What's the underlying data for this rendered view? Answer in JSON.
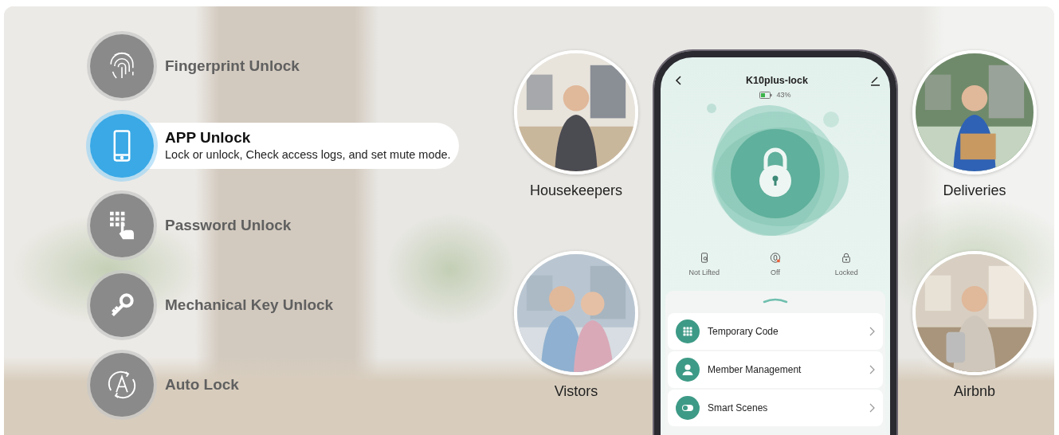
{
  "features": [
    {
      "kind": "fingerprint",
      "title": "Fingerprint Unlock",
      "selected": false
    },
    {
      "kind": "phone",
      "title": "APP Unlock",
      "description": "Lock or unlock, Check access logs, and set mute mode.",
      "selected": true
    },
    {
      "kind": "keypad",
      "title": "Password Unlock",
      "selected": false
    },
    {
      "kind": "key",
      "title": "Mechanical Key Unlock",
      "selected": false
    },
    {
      "kind": "auto",
      "title": "Auto Lock",
      "selected": false
    }
  ],
  "audiences_left": [
    {
      "label": "Housekeepers"
    },
    {
      "label": "Vistors"
    }
  ],
  "audiences_right": [
    {
      "label": "Deliveries"
    },
    {
      "label": "Airbnb"
    }
  ],
  "app": {
    "title": "K10plus-lock",
    "battery": "43%",
    "statuses": [
      {
        "kind": "lift",
        "label": "Not Lifted"
      },
      {
        "kind": "privacy",
        "label": "Off"
      },
      {
        "kind": "lock",
        "label": "Locked"
      }
    ],
    "menu": [
      {
        "kind": "grid",
        "label": "Temporary Code"
      },
      {
        "kind": "person",
        "label": "Member Management"
      },
      {
        "kind": "toggle",
        "label": "Smart Scenes"
      }
    ]
  }
}
